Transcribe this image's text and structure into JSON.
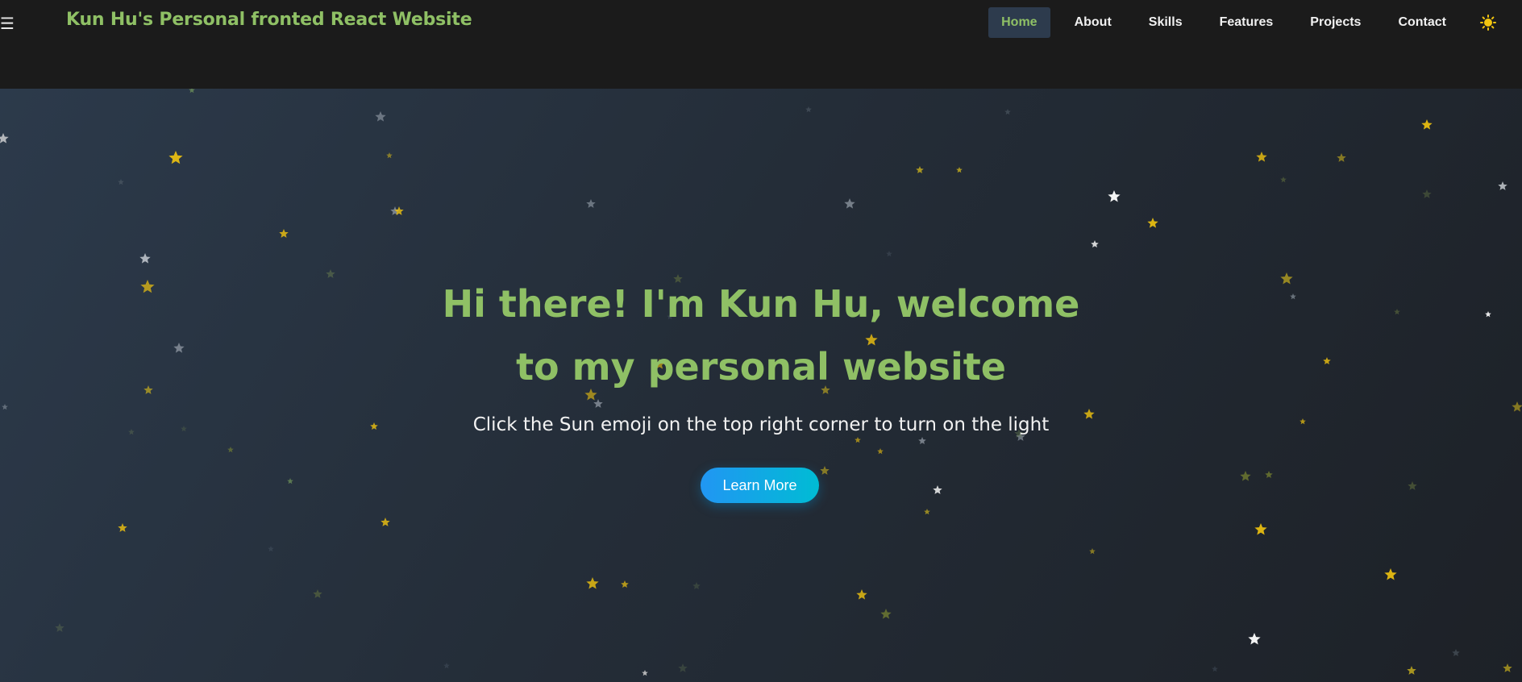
{
  "header": {
    "menu_icon": "hamburger-menu-icon",
    "brand": "Kun Hu's Personal fronted React Website",
    "nav": [
      "Home",
      "About",
      "Skills",
      "Features",
      "Projects",
      "Contact"
    ],
    "active": "Home",
    "theme_toggle_icon": "sun-emoji-icon"
  },
  "hero": {
    "title": "Hi there! I'm Kun Hu, welcome to my personal website",
    "subtitle": "Click the Sun emoji on the top right corner to turn on the light",
    "button": "Learn More"
  },
  "colors": {
    "accent_green": "#8fc065",
    "star_gold": "#f1c40f",
    "button_start": "#2196f3",
    "button_end": "#00bcd4",
    "nav_active_bg": "#2d3b4d"
  }
}
